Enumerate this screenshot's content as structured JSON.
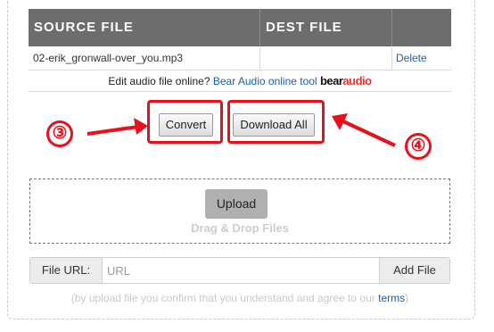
{
  "table": {
    "headers": [
      "SOURCE FILE",
      "DEST FILE"
    ],
    "rows": [
      {
        "source": "02-erik_gronwall-over_you.mp3",
        "dest": "",
        "action": "Delete"
      }
    ]
  },
  "edit_line": {
    "prefix": "Edit audio file online?",
    "link": "Bear Audio online tool",
    "logo_bear": "bear",
    "logo_audio": "audio"
  },
  "actions": {
    "convert_label": "Convert",
    "download_all_label": "Download All"
  },
  "annotations": {
    "step3": "③",
    "step4": "④",
    "color": "#e8101a"
  },
  "upload": {
    "button_label": "Upload",
    "drag_text": "Drag & Drop Files"
  },
  "url": {
    "label": "File URL:",
    "placeholder": "URL",
    "value": "",
    "add_label": "Add File"
  },
  "consent": {
    "text": "(by upload file you confirm that you understand and agree to our",
    "terms": "terms",
    "suffix": ")"
  }
}
